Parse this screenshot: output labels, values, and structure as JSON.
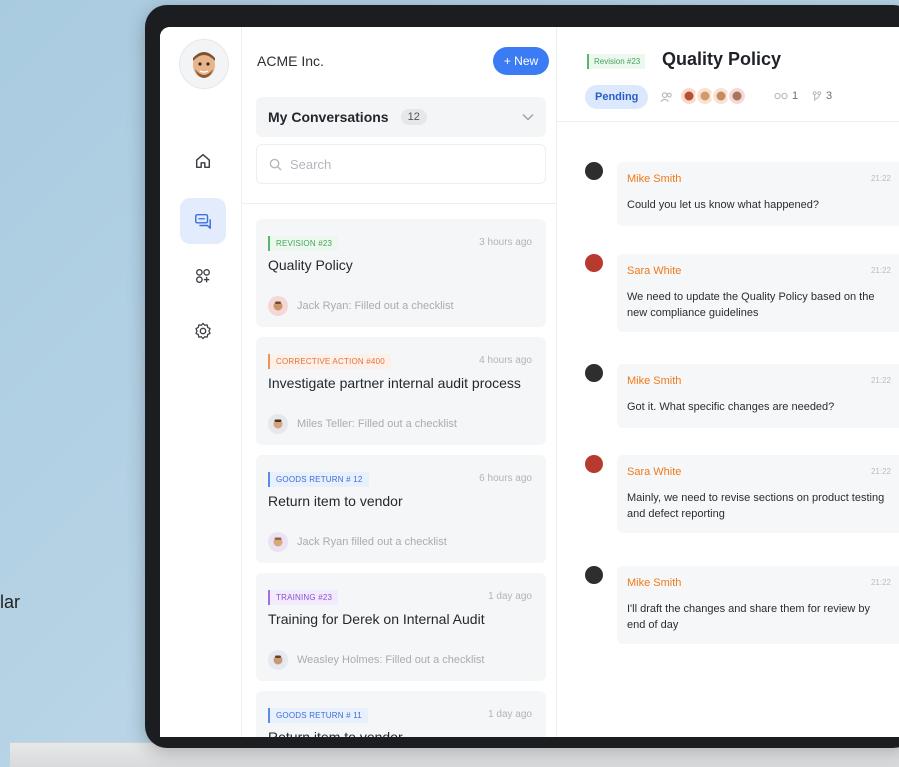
{
  "background_text": "lar",
  "org": {
    "name": "ACME Inc.",
    "new_button": "+ New"
  },
  "conversations": {
    "title": "My Conversations",
    "count": "12",
    "search_placeholder": "Search",
    "items": [
      {
        "tag": "REVISION #23",
        "tag_color": "#47a35a",
        "tag_bg": "#ecf7ee",
        "time": "3 hours ago",
        "title": "Quality Policy",
        "footer": "Jack Ryan: Filled out a checklist"
      },
      {
        "tag": "CORRECTIVE ACTION #400",
        "tag_color": "#e0733a",
        "tag_bg": "#fdf0e8",
        "time": "4 hours ago",
        "title": "Investigate partner internal audit process",
        "footer": "Miles Teller: Filled out a checklist"
      },
      {
        "tag": "GOODS RETURN # 12",
        "tag_color": "#3b6fd8",
        "tag_bg": "#e8effd",
        "time": "6 hours ago",
        "title": "Return item to vendor",
        "footer": "Jack Ryan filled out a checklist"
      },
      {
        "tag": "TRAINING #23",
        "tag_color": "#8b4fd6",
        "tag_bg": "#f2eafd",
        "time": "1 day ago",
        "title": "Training for Derek on Internal Audit",
        "footer": "Weasley Holmes: Filled out a checklist"
      },
      {
        "tag": "GOODS RETURN # 11",
        "tag_color": "#3b6fd8",
        "tag_bg": "#e8effd",
        "time": "1 day ago",
        "title": "Return item to vendor",
        "footer": ""
      }
    ]
  },
  "chat": {
    "tag": "Revision #23",
    "title": "Quality Policy",
    "status": "Pending",
    "links_count": "1",
    "branches_count": "3",
    "messages": [
      {
        "author": "Mike Smith",
        "time": "21:22",
        "text": "Could you let us know what happened?"
      },
      {
        "author": "Sara White",
        "time": "21:22",
        "text": "We need to update the Quality Policy based on the new compliance guidelines"
      },
      {
        "author": "Mike Smith",
        "time": "21:22",
        "text": "Got it. What specific changes are needed?"
      },
      {
        "author": "Sara White",
        "time": "21:22",
        "text": "Mainly, we need to revise sections on product testing and defect reporting"
      },
      {
        "author": "Mike Smith",
        "time": "21:22",
        "text": "I'll draft the changes and share them for review by end of day"
      }
    ]
  },
  "icons": {
    "rail": [
      "home-icon",
      "chat-icon",
      "apps-icon",
      "settings-icon"
    ]
  }
}
